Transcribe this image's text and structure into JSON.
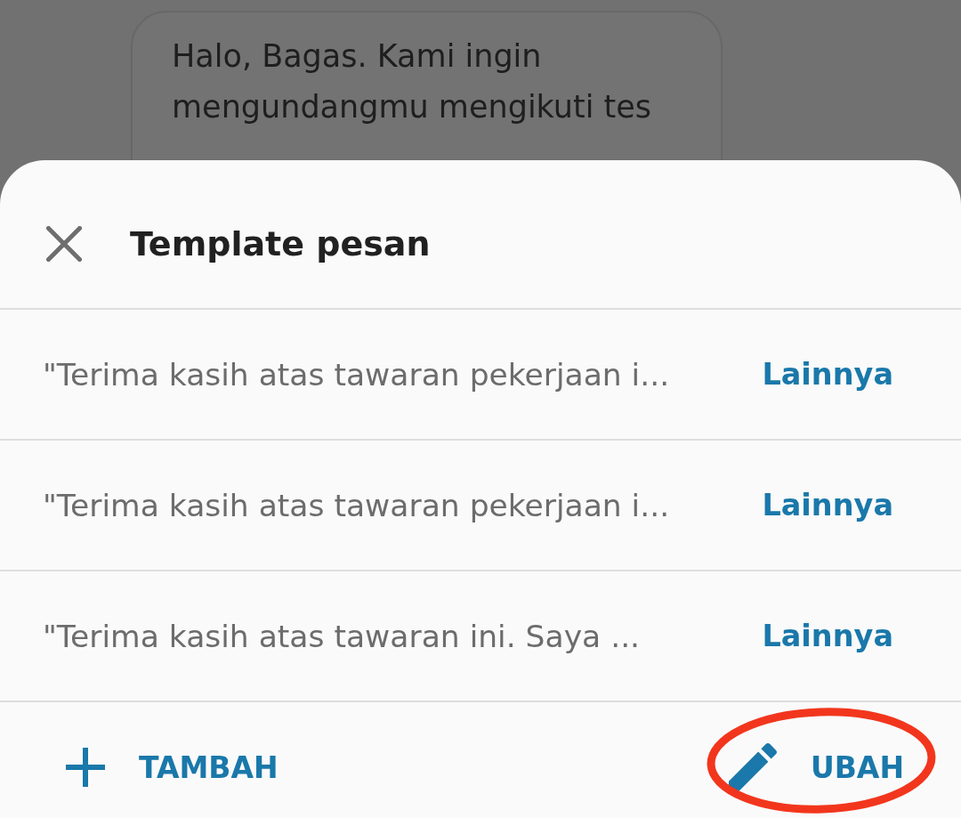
{
  "chat_bubble": {
    "text": "Halo, Bagas. Kami ingin mengundangmu mengikuti tes"
  },
  "sheet": {
    "title": "Template pesan",
    "templates": [
      {
        "text": "\"Terima kasih atas tawaran pekerjaan i...",
        "action": "Lainnya"
      },
      {
        "text": "\"Terima kasih atas tawaran pekerjaan i...",
        "action": "Lainnya"
      },
      {
        "text": "\"Terima kasih atas tawaran ini. Saya ...",
        "action": "Lainnya"
      }
    ],
    "actions": [
      {
        "kind": "add",
        "label": "TAMBAH",
        "highlighted": false
      },
      {
        "kind": "edit",
        "label": "UBAH",
        "highlighted": true
      }
    ]
  }
}
